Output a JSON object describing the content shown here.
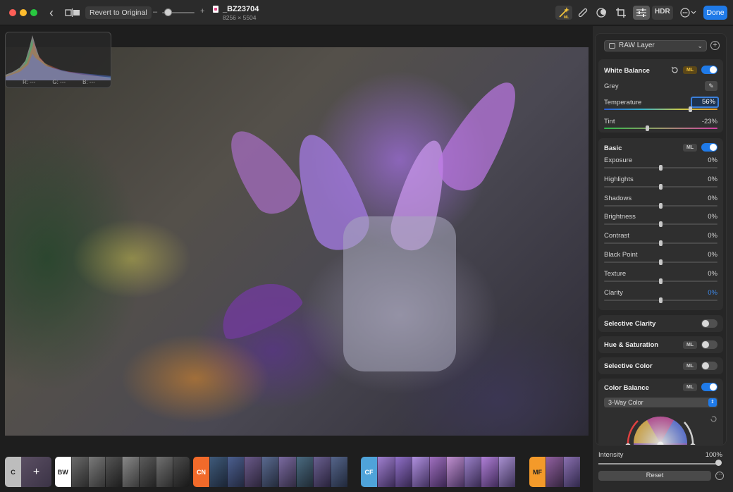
{
  "toolbar": {
    "revert_label": "Revert to Original",
    "zoom_minus": "–",
    "zoom_plus": "+",
    "file_name": "_BZ23704",
    "file_dimensions": "8256 × 5504",
    "hdr_label": "HDR",
    "done_label": "Done",
    "ml_badge": "ML",
    "more_glyph": "⋯",
    "back_glyph": "‹"
  },
  "histogram": {
    "r_label": "R: ---",
    "g_label": "G: ---",
    "b_label": "B: ---"
  },
  "panel": {
    "layer_select": "RAW Layer",
    "add_glyph": "+",
    "white_balance": {
      "title": "White Balance",
      "ml": "ML",
      "grey_label": "Grey",
      "temperature_label": "Temperature",
      "temperature_value": "56%",
      "temperature_level": 0.76,
      "tint_label": "Tint",
      "tint_value": "-23%",
      "tint_level": 0.38
    },
    "basic": {
      "title": "Basic",
      "ml": "ML",
      "rows": [
        {
          "label": "Exposure",
          "value": "0%"
        },
        {
          "label": "Highlights",
          "value": "0%"
        },
        {
          "label": "Shadows",
          "value": "0%"
        },
        {
          "label": "Brightness",
          "value": "0%"
        },
        {
          "label": "Contrast",
          "value": "0%"
        },
        {
          "label": "Black Point",
          "value": "0%"
        },
        {
          "label": "Texture",
          "value": "0%"
        },
        {
          "label": "Clarity",
          "value": "0%"
        }
      ]
    },
    "selective_clarity": {
      "title": "Selective Clarity"
    },
    "hue_saturation": {
      "title": "Hue & Saturation",
      "ml": "ML"
    },
    "selective_color": {
      "title": "Selective Color",
      "ml": "ML"
    },
    "color_balance": {
      "title": "Color Balance",
      "ml": "ML",
      "mode": "3-Way Color"
    },
    "intensity_label": "Intensity",
    "intensity_value": "100%",
    "reset_label": "Reset",
    "more_glyph": "⋯"
  },
  "filmstrip": {
    "groups": [
      {
        "tag": "C",
        "plus": "+"
      },
      {
        "tag": "BW"
      },
      {
        "tag": "CN"
      },
      {
        "tag": "CF"
      },
      {
        "tag": "MF"
      }
    ]
  },
  "colors": {
    "accent_blue": "#1f7ae8",
    "ml_gold": "#f2c33a",
    "cn_orange": "#f26a2a",
    "cf_blue": "#4fa3d9",
    "mf_orange": "#f49a2a"
  }
}
